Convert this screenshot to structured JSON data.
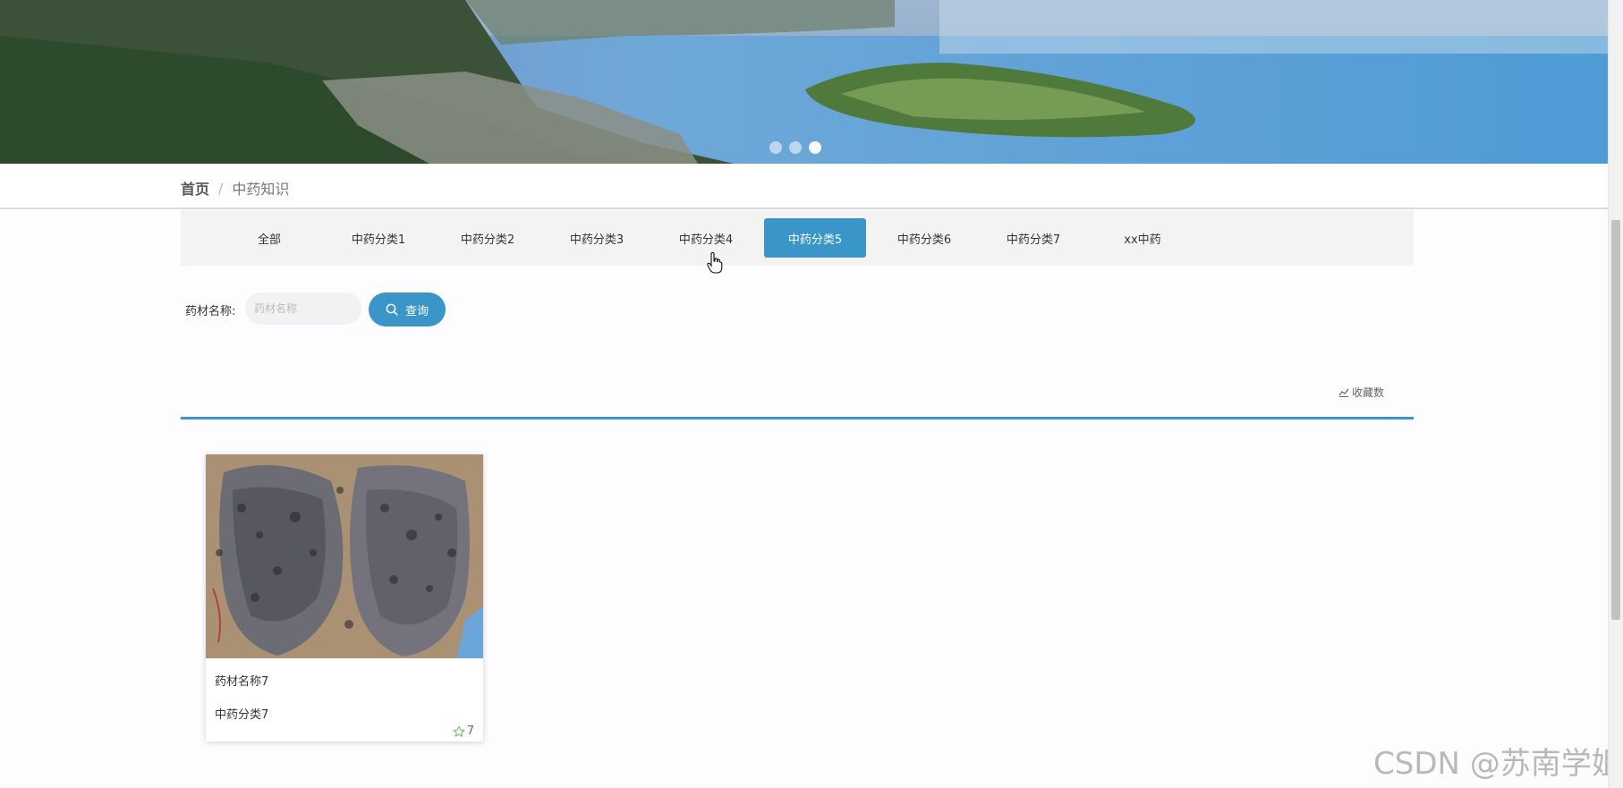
{
  "banner": {
    "slides": 3,
    "active_slide": 1
  },
  "breadcrumb": {
    "home": "首页",
    "separator": "/",
    "current": "中药知识"
  },
  "tabs": [
    {
      "label": "全部"
    },
    {
      "label": "中药分类1"
    },
    {
      "label": "中药分类2"
    },
    {
      "label": "中药分类3"
    },
    {
      "label": "中药分类4"
    },
    {
      "label": "中药分类5",
      "active": true
    },
    {
      "label": "中药分类6"
    },
    {
      "label": "中药分类7"
    },
    {
      "label": "xx中药"
    }
  ],
  "search": {
    "label": "药材名称:",
    "placeholder": "药材名称",
    "value": "",
    "button_label": "查询"
  },
  "sort": {
    "label": "收藏数",
    "icon": "chart-icon"
  },
  "cards": [
    {
      "name": "药材名称7",
      "category": "中药分类7",
      "favorites": "7",
      "icon": "star-icon"
    }
  ],
  "watermark": "CSDN @苏南学姐",
  "colors": {
    "accent": "#3a95c9",
    "tab_bg": "#f3f3f3"
  }
}
